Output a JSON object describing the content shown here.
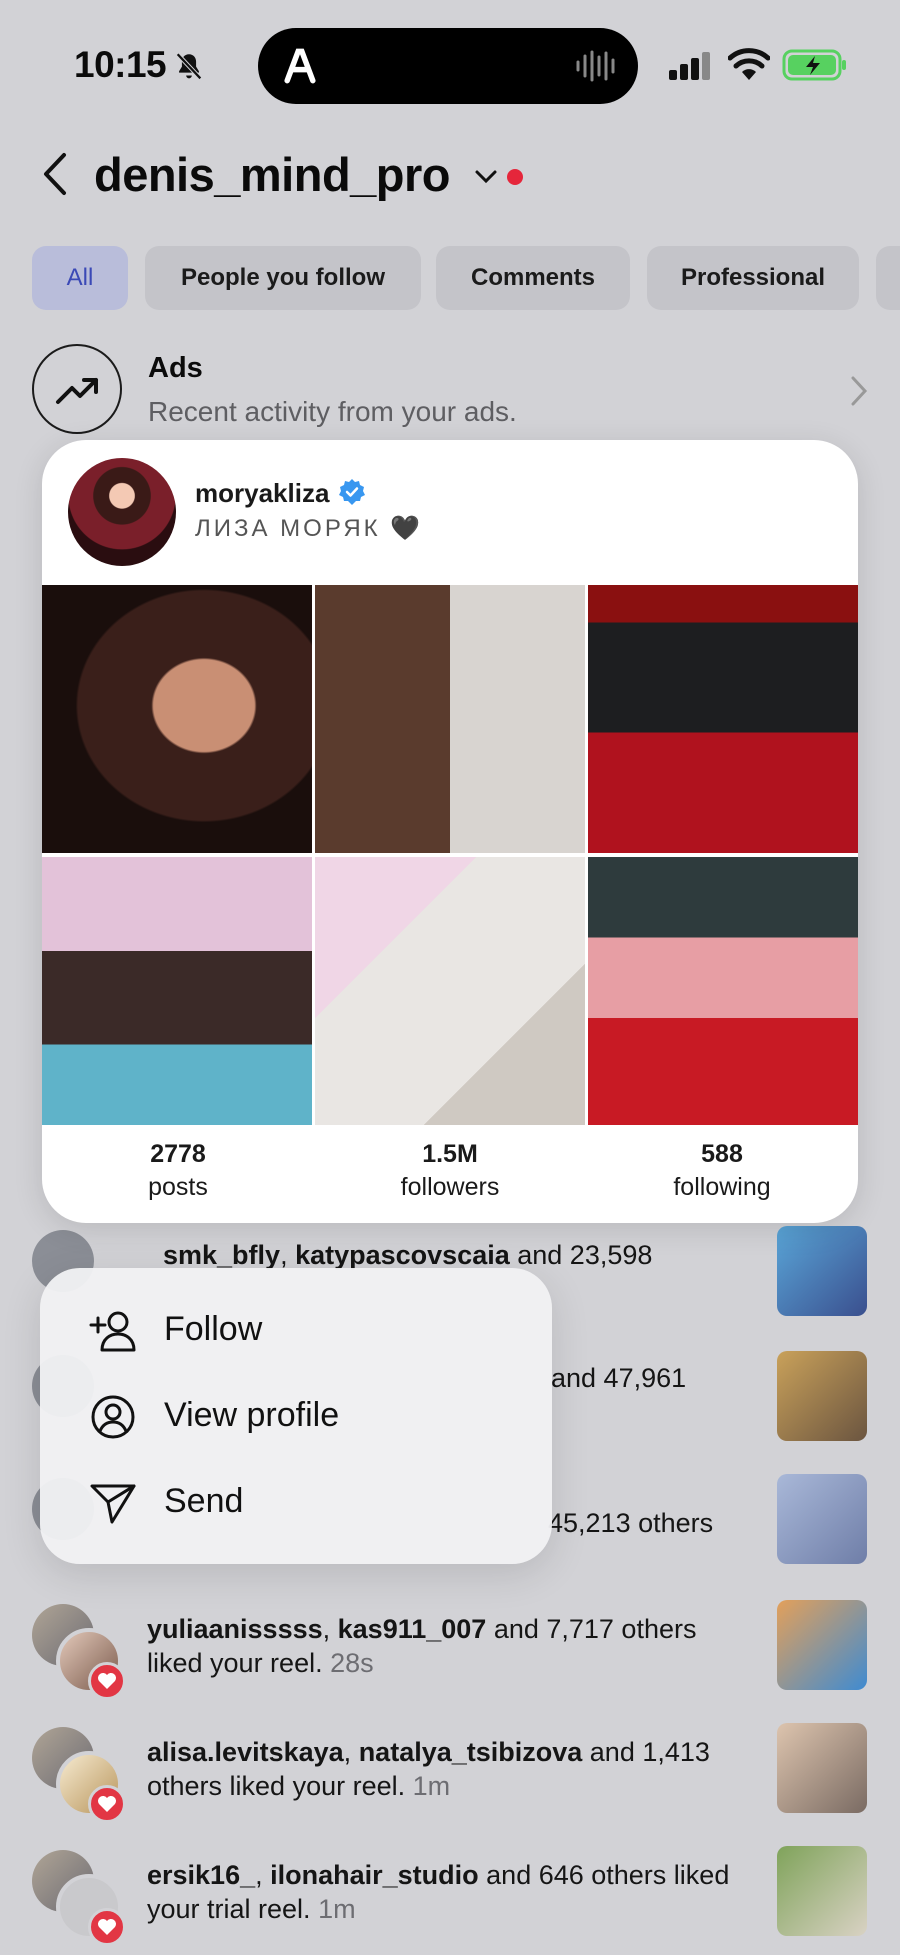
{
  "status_bar": {
    "time": "10:15",
    "icons": [
      "bell-slash-icon",
      "app-glyph-icon",
      "audio-wave-icon",
      "cellular-signal-icon",
      "wifi-icon",
      "battery-charging-icon"
    ],
    "battery_color": "#57d160"
  },
  "header": {
    "username": "denis_mind_pro",
    "notification_dot_color": "#e5263b"
  },
  "filters": {
    "items": [
      {
        "label": "All",
        "active": true
      },
      {
        "label": "People you follow",
        "active": false
      },
      {
        "label": "Comments",
        "active": false
      },
      {
        "label": "Professional",
        "active": false
      }
    ]
  },
  "ads": {
    "title": "Ads",
    "subtitle": "Recent activity from your ads."
  },
  "preview": {
    "username": "moryakliza",
    "bio": "ЛИЗА МОРЯК 🖤",
    "verified": true,
    "stats": [
      {
        "value": "2778",
        "label": "posts"
      },
      {
        "value": "1.5M",
        "label": "followers"
      },
      {
        "value": "588",
        "label": "following"
      }
    ]
  },
  "menu": {
    "items": [
      {
        "label": "Follow",
        "icon": "add-person-icon"
      },
      {
        "label": "View profile",
        "icon": "profile-circle-icon"
      },
      {
        "label": "Send",
        "icon": "paper-plane-icon"
      }
    ]
  },
  "partial_rows": {
    "row1_users": "smk_bfly",
    "row1_users2": "katypascovscaia",
    "row1_suffix": "and 23,598",
    "row2_suffix": "and 47,961",
    "row3_suffix": "45,213 others"
  },
  "notifications": [
    {
      "user1": "yuliaanisssss",
      "user2": "kas911_007",
      "rest": " and 7,717 others liked your reel.",
      "time": "28s"
    },
    {
      "user1": "alisa.levitskaya",
      "user2": "natalya_tsibizova",
      "rest": " and 1,413 others liked your reel.",
      "time": "1m"
    },
    {
      "user1": "ersik16_",
      "user2": "ilonahair_studio",
      "rest": " and 646 others liked your trial reel.",
      "time": "1m"
    }
  ],
  "colors": {
    "background": "#d2d2d6",
    "chip_active_text": "#3b49b6",
    "heart_badge": "#e23644",
    "verified_badge": "#3897f0"
  }
}
